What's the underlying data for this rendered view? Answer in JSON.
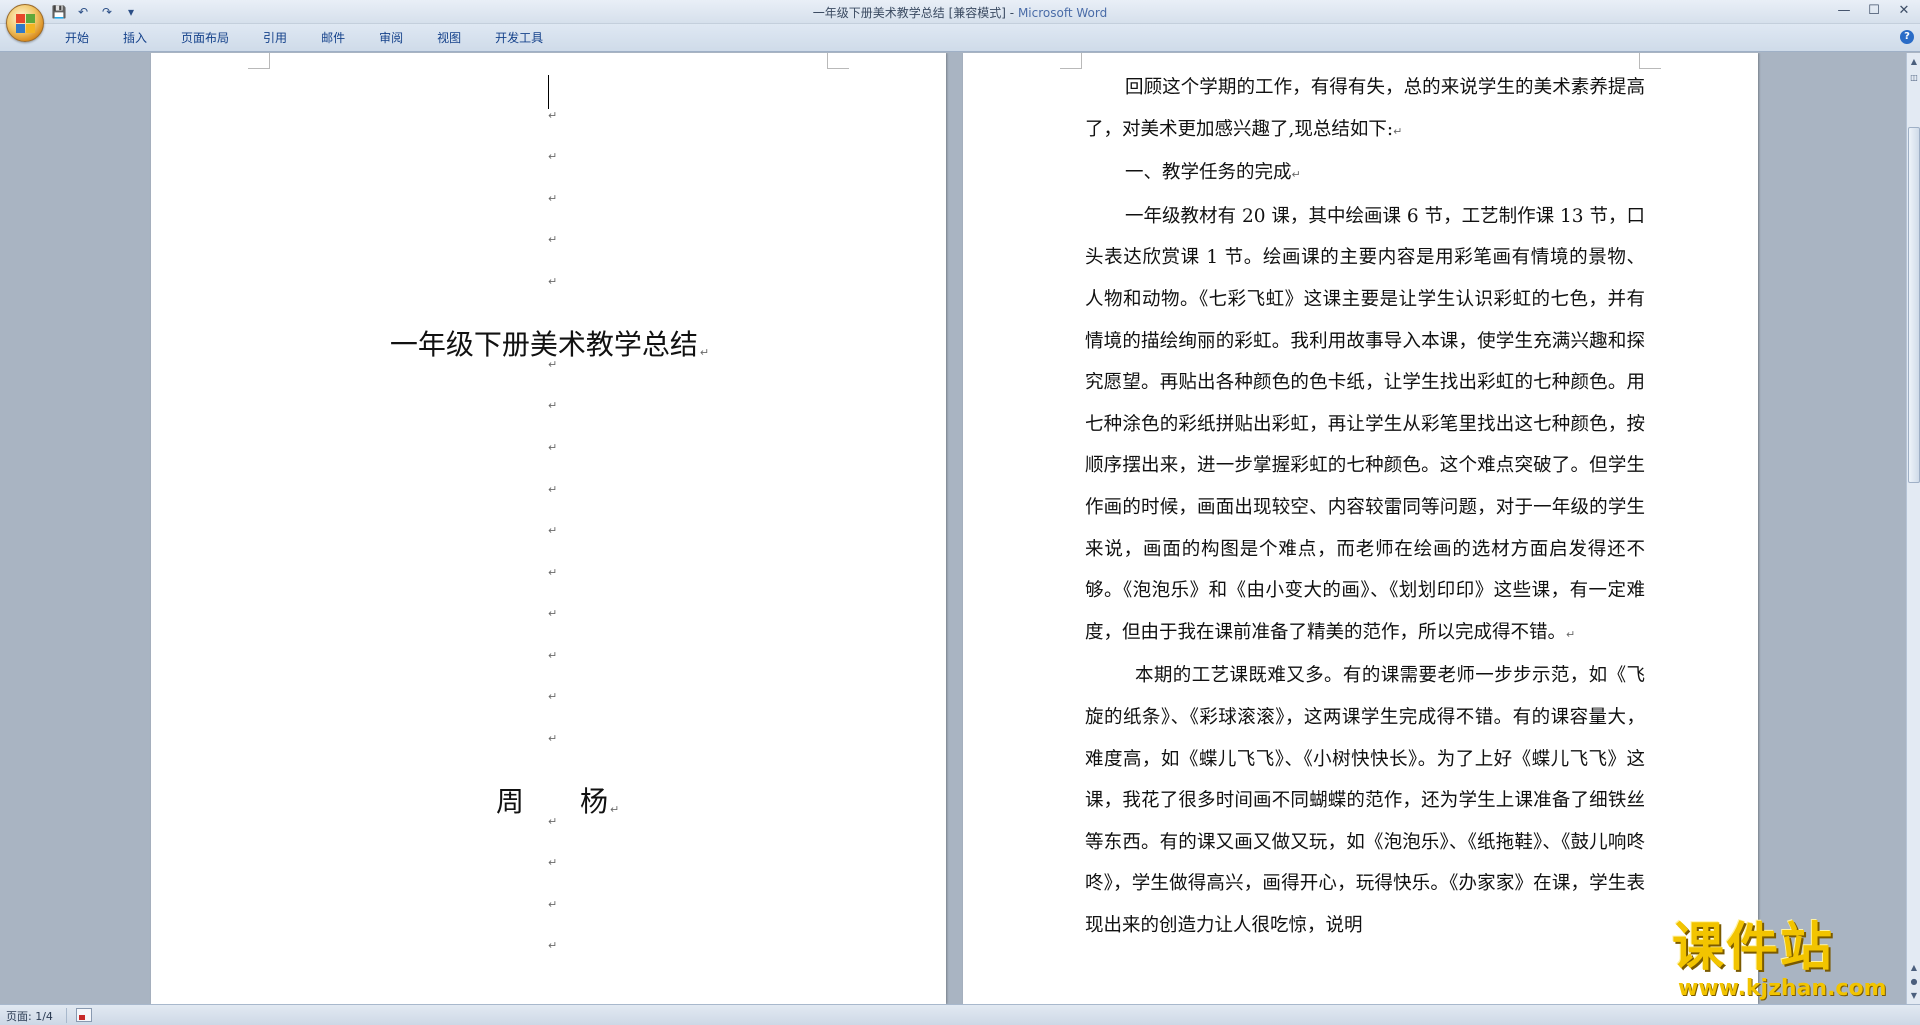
{
  "window": {
    "title": "一年级下册美术教学总结 [兼容模式]",
    "title_sep": " - ",
    "app": "Microsoft Word",
    "controls": [
      "—",
      "☐",
      "✕"
    ]
  },
  "quick_access": [
    {
      "icon": "save-icon",
      "glyph": "💾"
    },
    {
      "icon": "undo-icon",
      "glyph": "↶"
    },
    {
      "icon": "redo-icon",
      "glyph": "↷"
    },
    {
      "icon": "customize-icon",
      "glyph": "▾"
    }
  ],
  "ribbon": {
    "tabs": [
      "开始",
      "插入",
      "页面布局",
      "引用",
      "邮件",
      "审阅",
      "视图",
      "开发工具"
    ],
    "help_glyph": "?"
  },
  "page_left": {
    "title": "一年级下册美术教学总结",
    "author": "周　　杨",
    "para_mark": "↵"
  },
  "page_right": {
    "paragraphs": [
      "回顾这个学期的工作，有得有失，总的来说学生的美术素养提高了，对美术更加感兴趣了,现总结如下:",
      "一、教学任务的完成",
      "一年级教材有 20 课，其中绘画课 6 节，工艺制作课 13 节，口头表达欣赏课 1 节。绘画课的主要内容是用彩笔画有情境的景物、人物和动物。《七彩飞虹》这课主要是让学生认识彩虹的七色，并有情境的描绘绚丽的彩虹。我利用故事导入本课，使学生充满兴趣和探究愿望。再贴出各种颜色的色卡纸，让学生找出彩虹的七种颜色。用七种涂色的彩纸拼贴出彩虹，再让学生从彩笔里找出这七种颜色，按顺序摆出来，进一步掌握彩虹的七种颜色。这个难点突破了。但学生作画的时候，画面出现较空、内容较雷同等问题，对于一年级的学生来说，画面的构图是个难点，而老师在绘画的选材方面启发得还不够。《泡泡乐》和《由小变大的画》、《划划印印》这些课，有一定难度，但由于我在课前准备了精美的范作，所以完成得不错。",
      "本期的工艺课既难又多。有的课需要老师一步步示范，如《飞旋的纸条》、《彩球滚滚》，这两课学生完成得不错。有的课容量大，难度高，如《蝶儿飞飞》、《小树快快长》。为了上好《蝶儿飞飞》这课，我花了很多时间画不同蝴蝶的范作，还为学生上课准备了细铁丝等东西。有的课又画又做又玩，如《泡泡乐》、《纸拖鞋》、《鼓儿响咚咚》，学生做得高兴，画得开心，玩得快乐。《办家家》在课，学生表现出来的创造力让人很吃惊，说明"
    ],
    "para_mark": "↵"
  },
  "status": {
    "page": "页面: 1/4"
  },
  "watermark": {
    "main": "课件站",
    "sub": "www.kjzhan.com"
  },
  "colors": {
    "ribbon_text": "#15428b",
    "app_title": "#4a6ca8",
    "workspace": "#a9b4c2",
    "watermark": "#f2c400"
  }
}
